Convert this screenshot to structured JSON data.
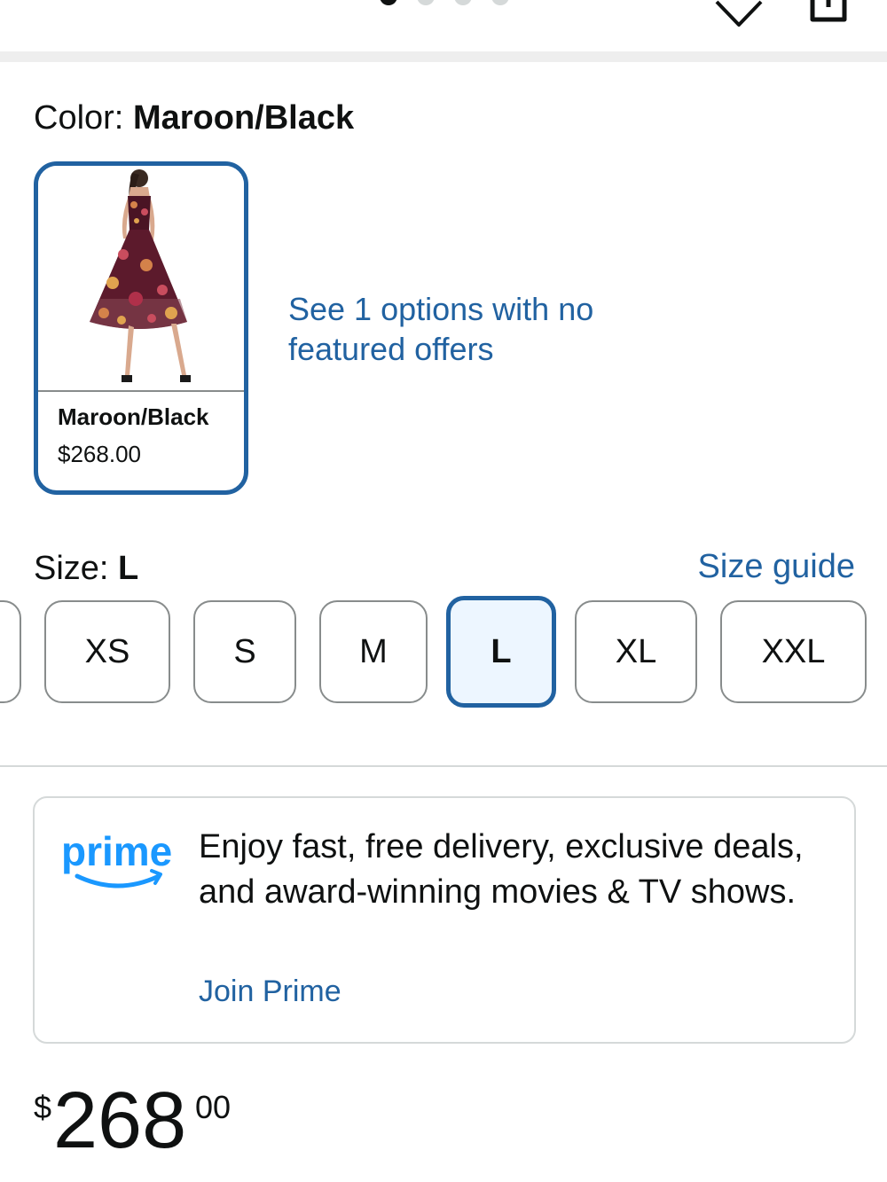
{
  "top": {
    "gallery_dots": [
      true,
      false,
      false,
      false
    ],
    "icons": [
      "heart-icon",
      "share-icon"
    ]
  },
  "color": {
    "label": "Color:",
    "value": "Maroon/Black"
  },
  "swatch": {
    "name": "Maroon/Black",
    "price": "$268.00",
    "image": "floral-midi-dress-photo"
  },
  "options_link": "See 1 options with no featured offers",
  "size": {
    "label": "Size:",
    "value": "L",
    "guide_label": "Size guide",
    "options": [
      "",
      "XS",
      "S",
      "M",
      "L",
      "XL",
      "XXL"
    ],
    "selected": "L"
  },
  "prime": {
    "logo_text": "prime",
    "message": "Enjoy fast, free delivery, exclusive deals, and award-winning movies & TV shows.",
    "join_label": "Join Prime"
  },
  "price": {
    "symbol": "$",
    "whole": "268",
    "fraction": "00"
  },
  "colors": {
    "link": "#2162a1",
    "selected_fill": "#edf6ff",
    "prime_blue": "#1a98ff",
    "text": "#0f1111"
  }
}
